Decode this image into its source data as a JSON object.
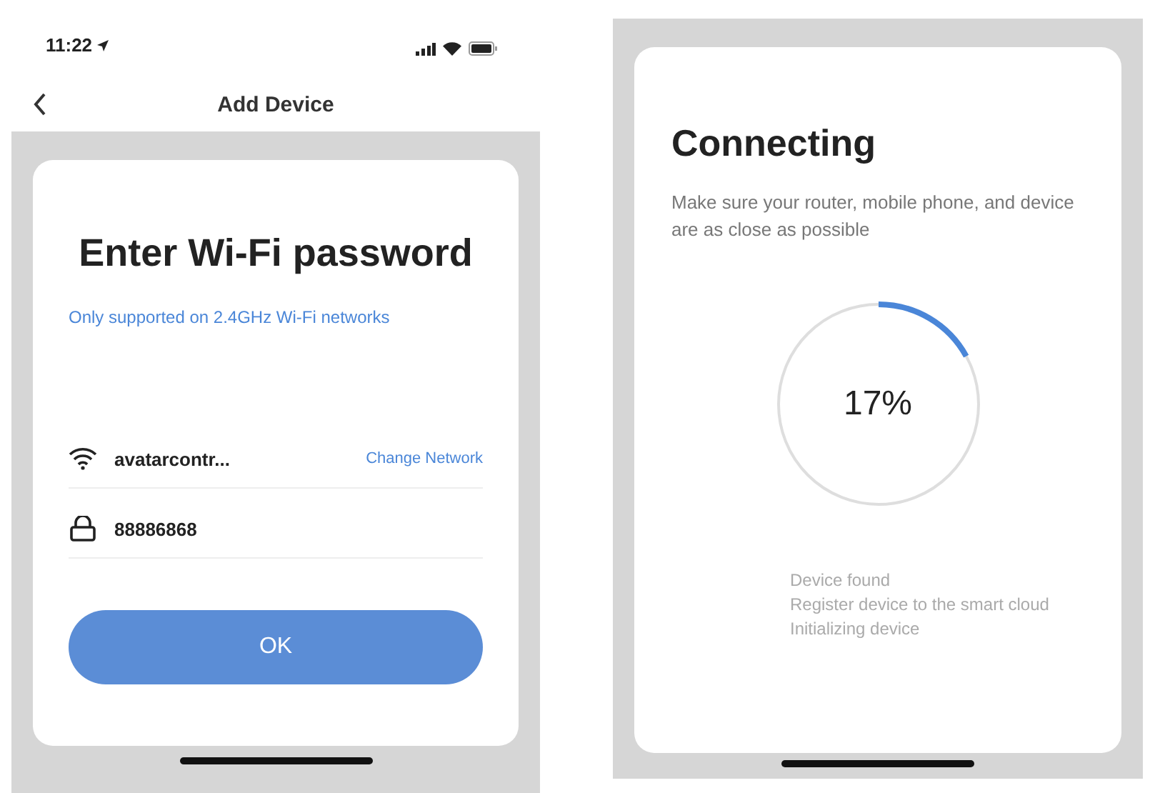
{
  "wifi_screen": {
    "status_bar": {
      "time": "11:22"
    },
    "nav_bar": {
      "title": "Add Device"
    },
    "card": {
      "title": "Enter Wi-Fi password",
      "note": "Only supported on 2.4GHz Wi-Fi networks",
      "network": {
        "name": "avatarcontr...",
        "link": "Change Network"
      },
      "password": {
        "value": "88886868"
      },
      "button": "OK"
    }
  },
  "connecting_screen": {
    "title": "Connecting",
    "message": "Make sure your router, mobile phone, and device are as close as possible",
    "progress": {
      "level": 0.17,
      "reading": "17%"
    },
    "steps": [
      "Device found",
      "Register device to the smart cloud",
      "Initializing device"
    ]
  }
}
